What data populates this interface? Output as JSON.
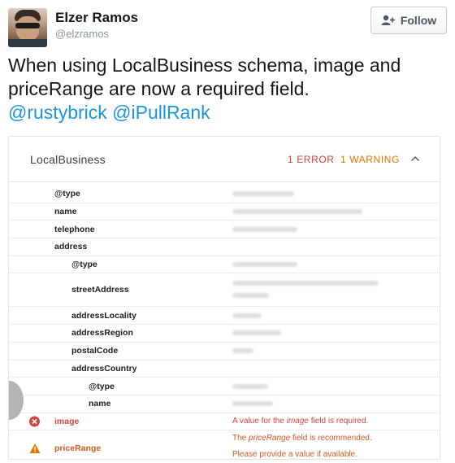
{
  "tweet": {
    "author_name": "Elzer Ramos",
    "author_handle": "@elzramos",
    "follow_label": "Follow",
    "text_line1": "When using LocalBusiness schema, image and",
    "text_line2": "priceRange are now a required field.",
    "mention1": "@rustybrick",
    "mention2": "@iPullRank"
  },
  "card": {
    "title": "LocalBusiness",
    "error_count": "1 ERROR",
    "warning_count": "1 WARNING",
    "properties": [
      "@type",
      "name",
      "telephone",
      "address",
      "@type",
      "streetAddress",
      "addressLocality",
      "addressRegion",
      "postalCode",
      "addressCountry",
      "@type",
      "name"
    ],
    "error": {
      "property": "image",
      "message_prefix": "A value for the ",
      "message_field": "image",
      "message_suffix": " field is required."
    },
    "warning": {
      "property": "priceRange",
      "message_prefix": "The ",
      "message_field": "priceRange",
      "message_suffix": " field is recommended.",
      "message_line2": "Please provide a value if available."
    }
  },
  "colors": {
    "mention": "#1b95e0",
    "error": "#d0463b",
    "warning": "#e37400"
  }
}
